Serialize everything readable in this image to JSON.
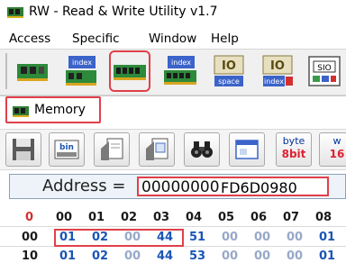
{
  "window": {
    "title": "RW - Read & Write Utility v1.7"
  },
  "menu": {
    "items": [
      "Access",
      "Specific",
      "Window",
      "Help"
    ]
  },
  "toolbar": {
    "buttons": [
      {
        "icon": "pci-card-icon"
      },
      {
        "icon": "pci-index-icon",
        "badge": "index"
      },
      {
        "icon": "memory-icon"
      },
      {
        "icon": "memory-index-icon",
        "badge": "index"
      },
      {
        "icon": "io-space-icon",
        "badge": "space"
      },
      {
        "icon": "io-index-icon",
        "badge": "index"
      },
      {
        "icon": "sio-icon",
        "badge": "SIO"
      }
    ],
    "selected": "memory-icon"
  },
  "memory_window": {
    "title": "Memory",
    "toolbar": {
      "buttons": [
        {
          "icon": "save-icon"
        },
        {
          "icon": "bin-icon",
          "badge": "bin"
        },
        {
          "icon": "open-file-icon"
        },
        {
          "icon": "edit-file-icon"
        },
        {
          "icon": "binoculars-icon"
        },
        {
          "icon": "window-icon"
        }
      ],
      "byte_button": {
        "line1": "byte",
        "line2": "8bit"
      },
      "word_button": {
        "line1": "w",
        "line2": "16"
      }
    },
    "address": {
      "label": "Address =",
      "value": "00000000",
      "extra": "FD6D0980"
    },
    "grid": {
      "corner": "0",
      "columns": [
        "00",
        "01",
        "02",
        "03",
        "04",
        "05",
        "06",
        "07",
        "08"
      ],
      "rows": [
        {
          "label": "00",
          "cells": [
            "01",
            "02",
            "00",
            "44",
            "51",
            "00",
            "00",
            "00",
            "01"
          ]
        },
        {
          "label": "10",
          "cells": [
            "01",
            "02",
            "00",
            "44",
            "53",
            "00",
            "00",
            "00",
            "01"
          ]
        }
      ]
    }
  },
  "colors": {
    "accent_red": "#e0404a",
    "hex_blue": "#1a55b5",
    "hex_faint": "#98a8c8"
  }
}
